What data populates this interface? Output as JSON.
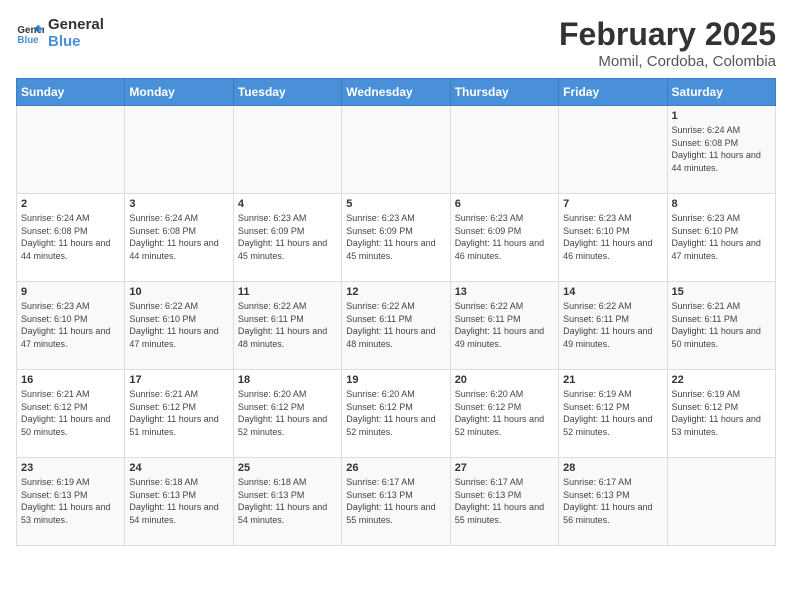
{
  "header": {
    "logo_line1": "General",
    "logo_line2": "Blue",
    "title": "February 2025",
    "subtitle": "Momil, Cordoba, Colombia"
  },
  "days_of_week": [
    "Sunday",
    "Monday",
    "Tuesday",
    "Wednesday",
    "Thursday",
    "Friday",
    "Saturday"
  ],
  "weeks": [
    [
      {
        "day": "",
        "info": ""
      },
      {
        "day": "",
        "info": ""
      },
      {
        "day": "",
        "info": ""
      },
      {
        "day": "",
        "info": ""
      },
      {
        "day": "",
        "info": ""
      },
      {
        "day": "",
        "info": ""
      },
      {
        "day": "1",
        "info": "Sunrise: 6:24 AM\nSunset: 6:08 PM\nDaylight: 11 hours and 44 minutes."
      }
    ],
    [
      {
        "day": "2",
        "info": "Sunrise: 6:24 AM\nSunset: 6:08 PM\nDaylight: 11 hours and 44 minutes."
      },
      {
        "day": "3",
        "info": "Sunrise: 6:24 AM\nSunset: 6:08 PM\nDaylight: 11 hours and 44 minutes."
      },
      {
        "day": "4",
        "info": "Sunrise: 6:23 AM\nSunset: 6:09 PM\nDaylight: 11 hours and 45 minutes."
      },
      {
        "day": "5",
        "info": "Sunrise: 6:23 AM\nSunset: 6:09 PM\nDaylight: 11 hours and 45 minutes."
      },
      {
        "day": "6",
        "info": "Sunrise: 6:23 AM\nSunset: 6:09 PM\nDaylight: 11 hours and 46 minutes."
      },
      {
        "day": "7",
        "info": "Sunrise: 6:23 AM\nSunset: 6:10 PM\nDaylight: 11 hours and 46 minutes."
      },
      {
        "day": "8",
        "info": "Sunrise: 6:23 AM\nSunset: 6:10 PM\nDaylight: 11 hours and 47 minutes."
      }
    ],
    [
      {
        "day": "9",
        "info": "Sunrise: 6:23 AM\nSunset: 6:10 PM\nDaylight: 11 hours and 47 minutes."
      },
      {
        "day": "10",
        "info": "Sunrise: 6:22 AM\nSunset: 6:10 PM\nDaylight: 11 hours and 47 minutes."
      },
      {
        "day": "11",
        "info": "Sunrise: 6:22 AM\nSunset: 6:11 PM\nDaylight: 11 hours and 48 minutes."
      },
      {
        "day": "12",
        "info": "Sunrise: 6:22 AM\nSunset: 6:11 PM\nDaylight: 11 hours and 48 minutes."
      },
      {
        "day": "13",
        "info": "Sunrise: 6:22 AM\nSunset: 6:11 PM\nDaylight: 11 hours and 49 minutes."
      },
      {
        "day": "14",
        "info": "Sunrise: 6:22 AM\nSunset: 6:11 PM\nDaylight: 11 hours and 49 minutes."
      },
      {
        "day": "15",
        "info": "Sunrise: 6:21 AM\nSunset: 6:11 PM\nDaylight: 11 hours and 50 minutes."
      }
    ],
    [
      {
        "day": "16",
        "info": "Sunrise: 6:21 AM\nSunset: 6:12 PM\nDaylight: 11 hours and 50 minutes."
      },
      {
        "day": "17",
        "info": "Sunrise: 6:21 AM\nSunset: 6:12 PM\nDaylight: 11 hours and 51 minutes."
      },
      {
        "day": "18",
        "info": "Sunrise: 6:20 AM\nSunset: 6:12 PM\nDaylight: 11 hours and 52 minutes."
      },
      {
        "day": "19",
        "info": "Sunrise: 6:20 AM\nSunset: 6:12 PM\nDaylight: 11 hours and 52 minutes."
      },
      {
        "day": "20",
        "info": "Sunrise: 6:20 AM\nSunset: 6:12 PM\nDaylight: 11 hours and 52 minutes."
      },
      {
        "day": "21",
        "info": "Sunrise: 6:19 AM\nSunset: 6:12 PM\nDaylight: 11 hours and 52 minutes."
      },
      {
        "day": "22",
        "info": "Sunrise: 6:19 AM\nSunset: 6:12 PM\nDaylight: 11 hours and 53 minutes."
      }
    ],
    [
      {
        "day": "23",
        "info": "Sunrise: 6:19 AM\nSunset: 6:13 PM\nDaylight: 11 hours and 53 minutes."
      },
      {
        "day": "24",
        "info": "Sunrise: 6:18 AM\nSunset: 6:13 PM\nDaylight: 11 hours and 54 minutes."
      },
      {
        "day": "25",
        "info": "Sunrise: 6:18 AM\nSunset: 6:13 PM\nDaylight: 11 hours and 54 minutes."
      },
      {
        "day": "26",
        "info": "Sunrise: 6:17 AM\nSunset: 6:13 PM\nDaylight: 11 hours and 55 minutes."
      },
      {
        "day": "27",
        "info": "Sunrise: 6:17 AM\nSunset: 6:13 PM\nDaylight: 11 hours and 55 minutes."
      },
      {
        "day": "28",
        "info": "Sunrise: 6:17 AM\nSunset: 6:13 PM\nDaylight: 11 hours and 56 minutes."
      },
      {
        "day": "",
        "info": ""
      }
    ]
  ]
}
